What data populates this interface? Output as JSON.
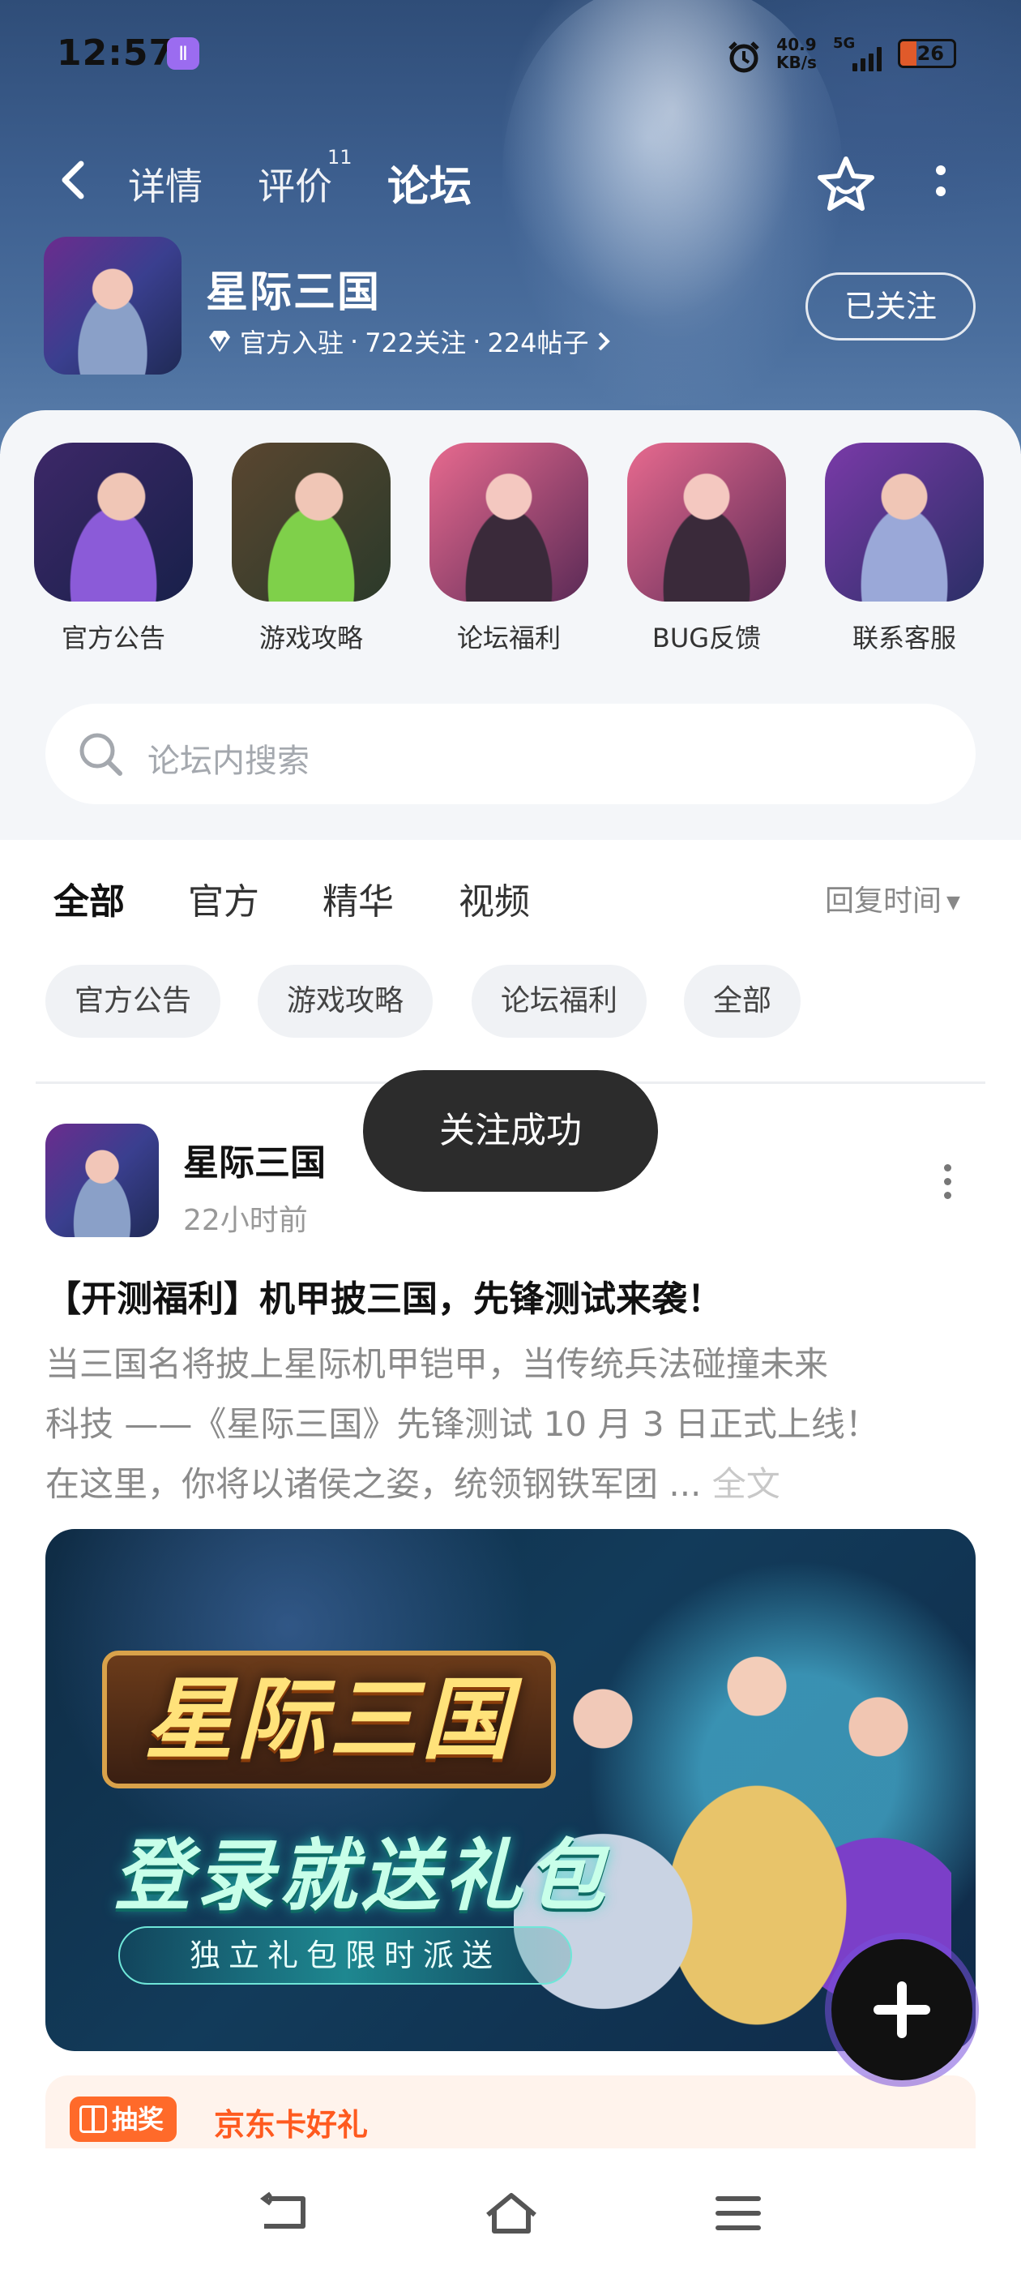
{
  "status_bar": {
    "time": "12:57",
    "app_badge": "Ⅱ",
    "net_speed_value": "40.9",
    "net_speed_unit": "KB/s",
    "network_type": "5G",
    "battery": "26"
  },
  "nav": {
    "tabs": [
      {
        "label": "详情"
      },
      {
        "label": "评价",
        "badge": "11"
      },
      {
        "label": "论坛",
        "active": true
      }
    ]
  },
  "game": {
    "name": "星际三国",
    "official": "官方入驻",
    "follows": "722关注",
    "posts": "224帖子",
    "sep": "·",
    "follow_button": "已关注"
  },
  "categories": [
    {
      "label": "官方公告"
    },
    {
      "label": "游戏攻略"
    },
    {
      "label": "论坛福利"
    },
    {
      "label": "BUG反馈"
    },
    {
      "label": "联系客服"
    }
  ],
  "search": {
    "placeholder": "论坛内搜索"
  },
  "filter_tabs": [
    {
      "label": "全部",
      "active": true
    },
    {
      "label": "官方"
    },
    {
      "label": "精华"
    },
    {
      "label": "视频"
    }
  ],
  "sort": {
    "label": "回复时间"
  },
  "chips": [
    {
      "label": "官方公告"
    },
    {
      "label": "游戏攻略"
    },
    {
      "label": "论坛福利"
    },
    {
      "label": "全部"
    }
  ],
  "toast": "关注成功",
  "post": {
    "author": "星际三国",
    "time": "22小时前",
    "title": "【开测福利】机甲披三国，先锋测试来袭！",
    "body_lines": [
      "当三国名将披上星际机甲铠甲，当传统兵法碰撞未来",
      "科技 ——《星际三国》先锋测试 10 月 3 日正式上线！",
      "在这里，你将以诸侯之姿，统领钢铁军团 ..."
    ],
    "more": "全文",
    "banner": {
      "logo": "星际三国",
      "slogan": "登录就送礼包",
      "sub": "独立礼包限时派送"
    }
  },
  "promo": {
    "tag": "抽奖",
    "text": "京东卡好礼"
  },
  "colors": {
    "accent": "#2ad6c8",
    "header_bg": "#3d5f8f",
    "promo": "#ff5a1f"
  }
}
